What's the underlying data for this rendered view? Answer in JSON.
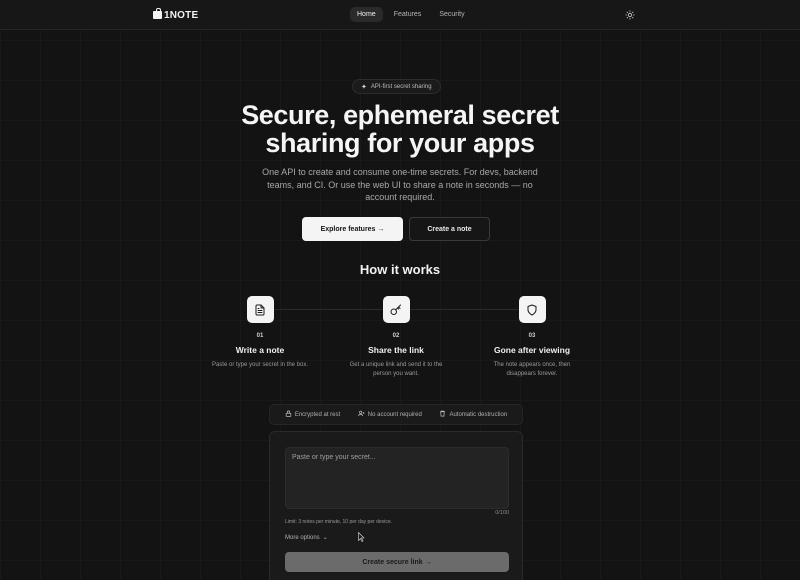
{
  "header": {
    "logo_text": "1NOTE",
    "nav": [
      {
        "label": "Home",
        "active": true
      },
      {
        "label": "Features",
        "active": false
      },
      {
        "label": "Security",
        "active": false
      }
    ],
    "theme_icon": "sun-icon"
  },
  "hero": {
    "badge": "API-first secret sharing",
    "title_line1": "Secure, ephemeral secret",
    "title_line2": "sharing for your apps",
    "subtitle": "One API to create and consume one-time secrets. For devs, backend teams, and CI. Or use the web UI to share a note in seconds — no account required.",
    "primary_button": "Explore features →",
    "secondary_button": "Create a note"
  },
  "how_it_works": {
    "title": "How it works",
    "steps": [
      {
        "num": "01",
        "title": "Write a note",
        "desc": "Paste or type your secret in the box.",
        "icon": "document-icon"
      },
      {
        "num": "02",
        "title": "Share the link",
        "desc": "Get a unique link and send it to the person you want.",
        "icon": "key-icon"
      },
      {
        "num": "03",
        "title": "Gone after viewing",
        "desc": "The note appears once, then disappears forever.",
        "icon": "shield-icon"
      }
    ]
  },
  "features": [
    {
      "label": "Encrypted at rest",
      "icon": "lock-icon"
    },
    {
      "label": "No account required",
      "icon": "user-x-icon"
    },
    {
      "label": "Automatic destruction",
      "icon": "trash-icon"
    }
  ],
  "form": {
    "placeholder": "Paste or type your secret...",
    "value": "",
    "counter": "0/100",
    "limit_text": "Limit: 3 notes per minute, 10 per day per device.",
    "more_options": "More options",
    "submit": "Create secure link →"
  },
  "colors": {
    "background": "#131313",
    "primary_button_bg": "#f4f4f4",
    "submit_button_bg": "#6b6b6b"
  }
}
